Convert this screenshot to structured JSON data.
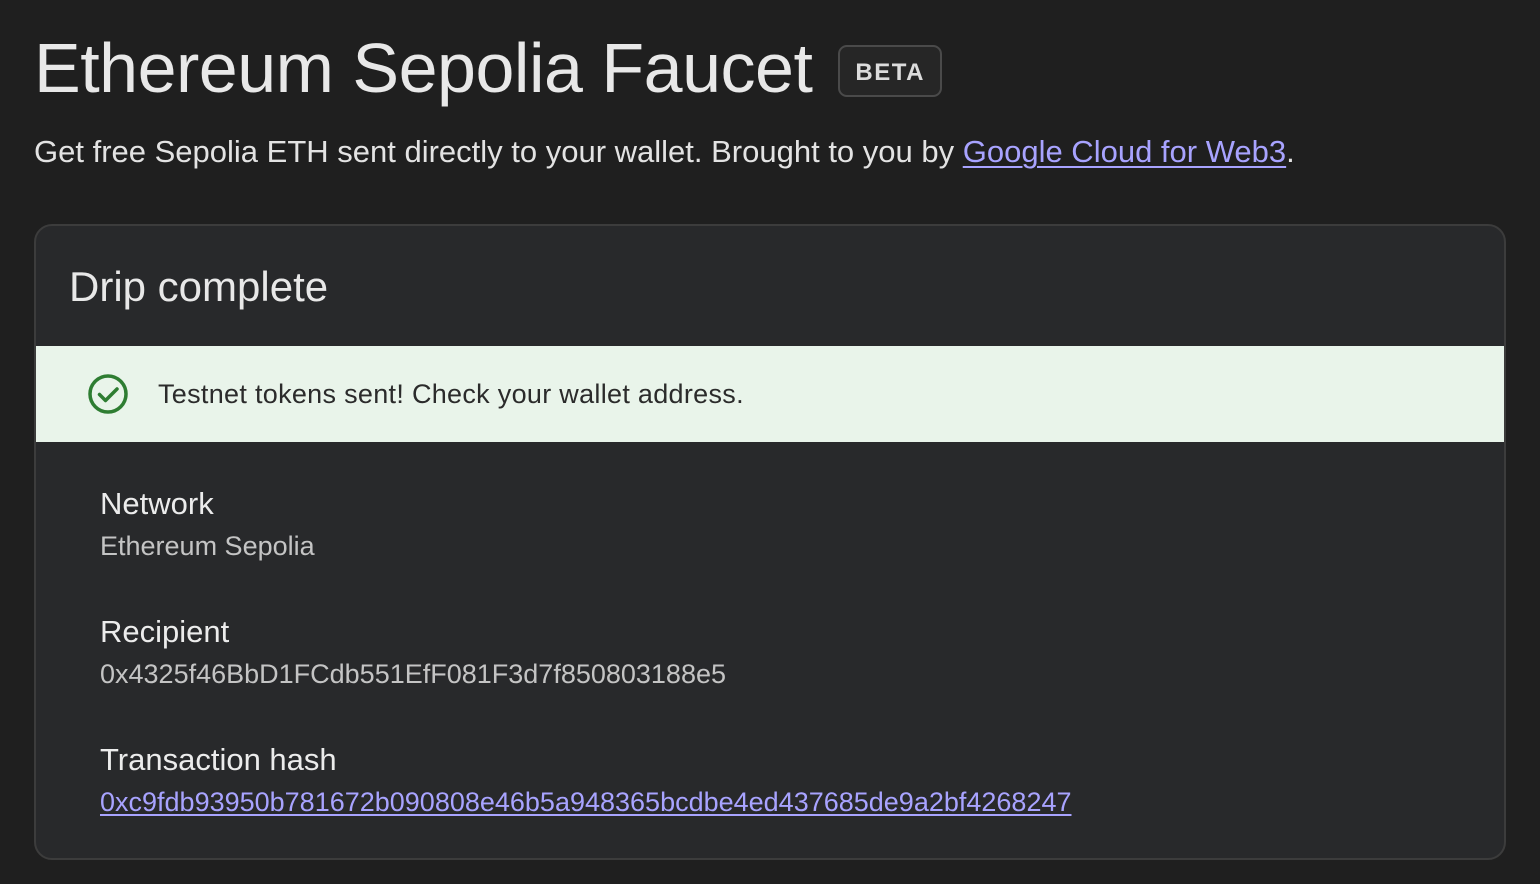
{
  "header": {
    "title": "Ethereum Sepolia Faucet",
    "badge": "BETA"
  },
  "subtitle": {
    "text": "Get free Sepolia ETH sent directly to your wallet. Brought to you by ",
    "link_label": "Google Cloud for Web3",
    "suffix": "."
  },
  "card": {
    "title": "Drip complete",
    "alert": {
      "icon": "check-circle-icon",
      "message": "Testnet tokens sent! Check your wallet address.",
      "color": "#2e7d32",
      "background": "#e9f4ea"
    },
    "fields": {
      "network": {
        "label": "Network",
        "value": "Ethereum Sepolia"
      },
      "recipient": {
        "label": "Recipient",
        "value": "0x4325f46BbD1FCdb551EfF081F3d7f850803188e5"
      },
      "transaction_hash": {
        "label": "Transaction hash",
        "value": "0xc9fdb93950b781672b090808e46b5a948365bcdbe4ed437685de9a2bf4268247"
      }
    }
  },
  "colors": {
    "background": "#1f1f1f",
    "card": "#28292b",
    "link": "#a8a3ff"
  }
}
